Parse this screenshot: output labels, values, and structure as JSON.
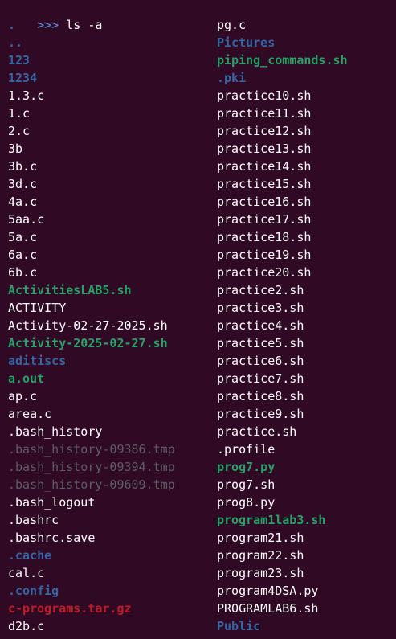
{
  "prompt": {
    "symbol": ">>>",
    "command": "ls -a"
  },
  "colors": {
    "background": "#300a24",
    "file": "#ffffff",
    "directory": "#3465a4",
    "executable": "#26a269",
    "archive": "#c01c28",
    "dim": "#5e5c64"
  },
  "listing": {
    "left": [
      {
        "name": ".",
        "type": "dir"
      },
      {
        "name": "..",
        "type": "dir"
      },
      {
        "name": "123",
        "type": "dir"
      },
      {
        "name": "1234",
        "type": "dir"
      },
      {
        "name": "1.3.c",
        "type": "file"
      },
      {
        "name": "1.c",
        "type": "file"
      },
      {
        "name": "2.c",
        "type": "file"
      },
      {
        "name": "3b",
        "type": "file"
      },
      {
        "name": "3b.c",
        "type": "file"
      },
      {
        "name": "3d.c",
        "type": "file"
      },
      {
        "name": "4a.c",
        "type": "file"
      },
      {
        "name": "5aa.c",
        "type": "file"
      },
      {
        "name": "5a.c",
        "type": "file"
      },
      {
        "name": "6a.c",
        "type": "file"
      },
      {
        "name": "6b.c",
        "type": "file"
      },
      {
        "name": "ActivitiesLAB5.sh",
        "type": "exec"
      },
      {
        "name": "ACTIVITY",
        "type": "file"
      },
      {
        "name": "Activity-02-27-2025.sh",
        "type": "file"
      },
      {
        "name": "Activity-2025-02-27.sh",
        "type": "exec"
      },
      {
        "name": "aditiscs",
        "type": "dir"
      },
      {
        "name": "a.out",
        "type": "exec"
      },
      {
        "name": "ap.c",
        "type": "file"
      },
      {
        "name": "area.c",
        "type": "file"
      },
      {
        "name": ".bash_history",
        "type": "file"
      },
      {
        "name": ".bash_history-09386.tmp",
        "type": "orphan"
      },
      {
        "name": ".bash_history-09394.tmp",
        "type": "orphan"
      },
      {
        "name": ".bash_history-09609.tmp",
        "type": "orphan"
      },
      {
        "name": ".bash_logout",
        "type": "file"
      },
      {
        "name": ".bashrc",
        "type": "file"
      },
      {
        "name": ".bashrc.save",
        "type": "file"
      },
      {
        "name": ".cache",
        "type": "dir"
      },
      {
        "name": "cal.c",
        "type": "file"
      },
      {
        "name": ".config",
        "type": "dir"
      },
      {
        "name": "c-programs.tar.gz",
        "type": "archive"
      },
      {
        "name": "d2b.c",
        "type": "file"
      }
    ],
    "right": [
      {
        "name": "pg.c",
        "type": "file"
      },
      {
        "name": "Pictures",
        "type": "dir"
      },
      {
        "name": "piping_commands.sh",
        "type": "exec"
      },
      {
        "name": ".pki",
        "type": "dir"
      },
      {
        "name": "practice10.sh",
        "type": "file"
      },
      {
        "name": "practice11.sh",
        "type": "file"
      },
      {
        "name": "practice12.sh",
        "type": "file"
      },
      {
        "name": "practice13.sh",
        "type": "file"
      },
      {
        "name": "practice14.sh",
        "type": "file"
      },
      {
        "name": "practice15.sh",
        "type": "file"
      },
      {
        "name": "practice16.sh",
        "type": "file"
      },
      {
        "name": "practice17.sh",
        "type": "file"
      },
      {
        "name": "practice18.sh",
        "type": "file"
      },
      {
        "name": "practice19.sh",
        "type": "file"
      },
      {
        "name": "practice20.sh",
        "type": "file"
      },
      {
        "name": "practice2.sh",
        "type": "file"
      },
      {
        "name": "practice3.sh",
        "type": "file"
      },
      {
        "name": "practice4.sh",
        "type": "file"
      },
      {
        "name": "practice5.sh",
        "type": "file"
      },
      {
        "name": "practice6.sh",
        "type": "file"
      },
      {
        "name": "practice7.sh",
        "type": "file"
      },
      {
        "name": "practice8.sh",
        "type": "file"
      },
      {
        "name": "practice9.sh",
        "type": "file"
      },
      {
        "name": "practice.sh",
        "type": "file"
      },
      {
        "name": ".profile",
        "type": "file"
      },
      {
        "name": "prog7.py",
        "type": "exec"
      },
      {
        "name": "prog7.sh",
        "type": "file"
      },
      {
        "name": "prog8.py",
        "type": "file"
      },
      {
        "name": "program1lab3.sh",
        "type": "exec"
      },
      {
        "name": "program21.sh",
        "type": "file"
      },
      {
        "name": "program22.sh",
        "type": "file"
      },
      {
        "name": "program23.sh",
        "type": "file"
      },
      {
        "name": "program4DSA.py",
        "type": "file"
      },
      {
        "name": "PROGRAMLAB6.sh",
        "type": "file"
      },
      {
        "name": "Public",
        "type": "dir"
      }
    ]
  }
}
